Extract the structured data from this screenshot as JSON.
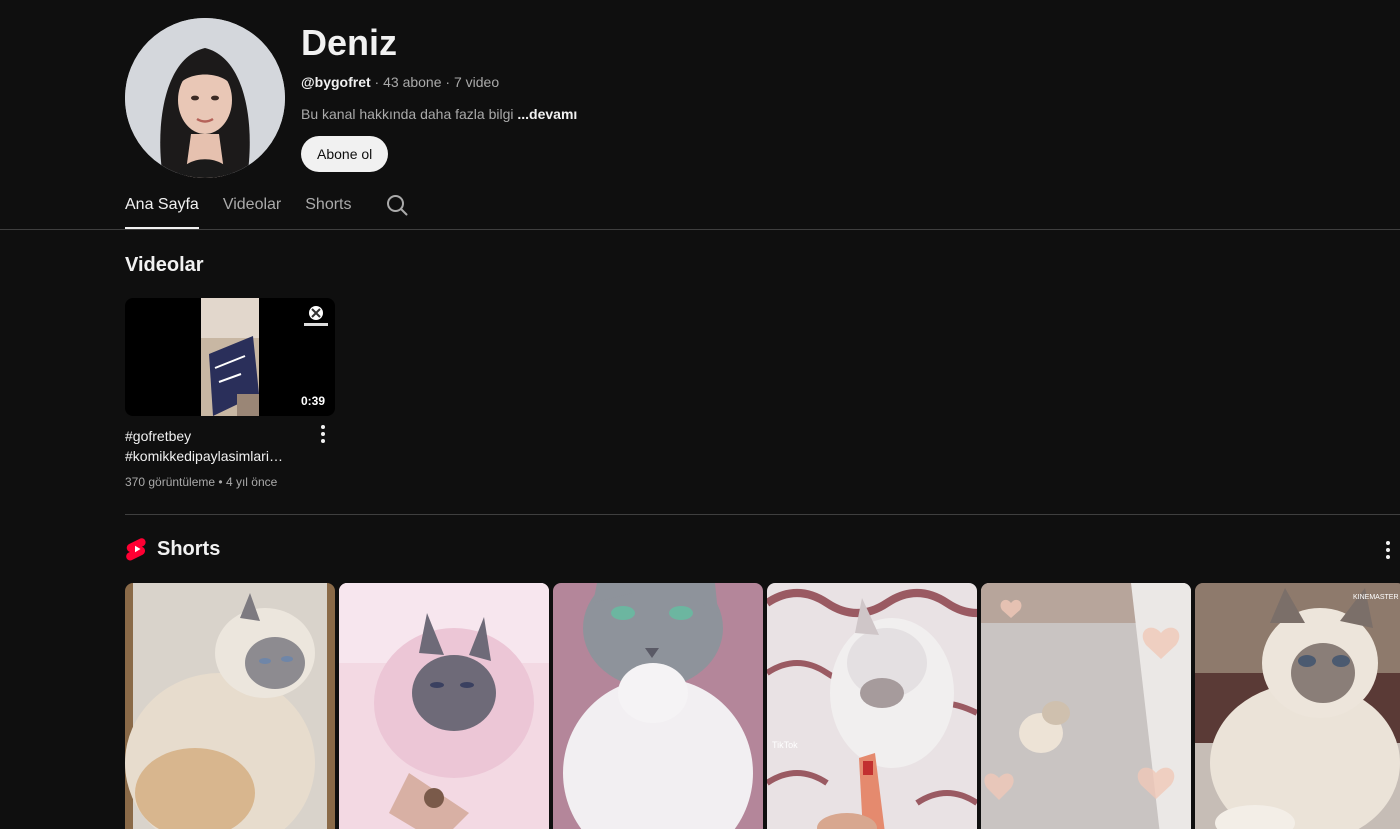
{
  "channel": {
    "name": "Deniz",
    "handle": "@bygofret",
    "subscribers": "43 abone",
    "video_count": "7 video",
    "separator": "·",
    "about_text": "Bu kanal hakkında daha fazla bilgi",
    "about_more": "...devamı",
    "subscribe_label": "Abone ol"
  },
  "tabs": [
    {
      "label": "Ana Sayfa",
      "active": true
    },
    {
      "label": "Videolar",
      "active": false
    },
    {
      "label": "Shorts",
      "active": false
    }
  ],
  "videos_section": {
    "title": "Videolar",
    "items": [
      {
        "title_line1": "#gofretbey",
        "title_line2": "#komikkedipaylasimlari…",
        "duration": "0:39",
        "views": "370 görüntüleme",
        "age": "4 yıl önce",
        "bullet": "•"
      }
    ]
  },
  "shorts_section": {
    "title": "Shorts",
    "accent": "#ff0033",
    "items": [
      {
        "name": "short-1"
      },
      {
        "name": "short-2"
      },
      {
        "name": "short-3"
      },
      {
        "name": "short-4"
      },
      {
        "name": "short-5"
      },
      {
        "name": "short-6"
      }
    ]
  },
  "icons": {
    "tab_search": "search-icon",
    "video_menu": "more-vertical-icon",
    "shorts_logo": "shorts-logo-icon",
    "shorts_menu": "more-vertical-icon"
  }
}
